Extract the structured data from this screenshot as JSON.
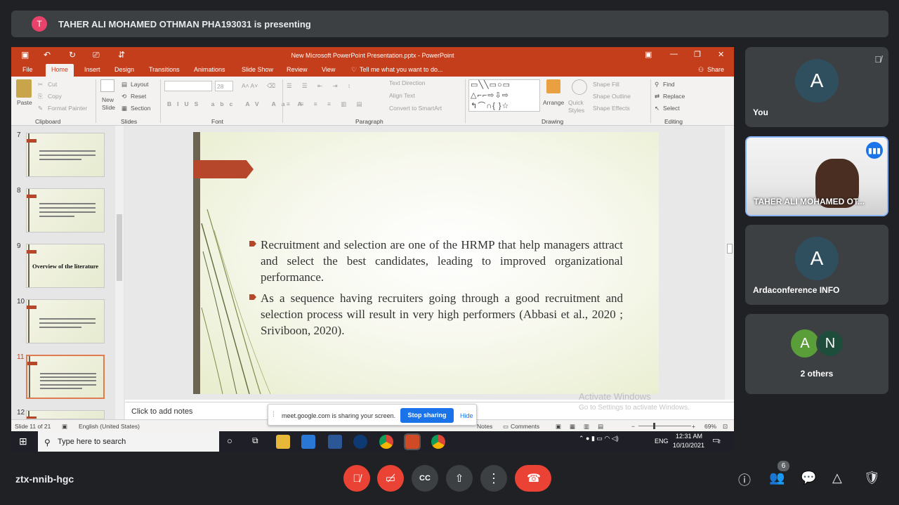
{
  "presenting_bar": {
    "avatar_letter": "T",
    "text": "TAHER ALI MOHAMED OTHMAN PHA193031 is presenting"
  },
  "ppt": {
    "title": "New Microsoft PowerPoint Presentation.pptx - PowerPoint",
    "menu": [
      "File",
      "Home",
      "Insert",
      "Design",
      "Transitions",
      "Animations",
      "Slide Show",
      "Review",
      "View"
    ],
    "tell_me": "Tell me what you want to do...",
    "share": "Share",
    "ribbon": {
      "clipboard": {
        "paste": "Paste",
        "cut": "Cut",
        "copy": "Copy",
        "format_painter": "Format Painter",
        "label": "Clipboard"
      },
      "slides": {
        "new_slide": "New Slide",
        "layout": "Layout",
        "reset": "Reset",
        "section": "Section",
        "label": "Slides"
      },
      "font": {
        "size": "28",
        "label": "Font"
      },
      "paragraph": {
        "text_direction": "Text Direction",
        "align_text": "Align Text",
        "convert": "Convert to SmartArt",
        "label": "Paragraph"
      },
      "drawing": {
        "arrange": "Arrange",
        "quick_styles": "Quick Styles",
        "shape_fill": "Shape Fill",
        "shape_outline": "Shape Outline",
        "shape_effects": "Shape Effects",
        "label": "Drawing"
      },
      "editing": {
        "find": "Find",
        "replace": "Replace",
        "select": "Select",
        "label": "Editing"
      }
    },
    "thumbnails": [
      {
        "num": "7"
      },
      {
        "num": "8"
      },
      {
        "num": "9",
        "title": "Overview of the literature"
      },
      {
        "num": "10"
      },
      {
        "num": "11",
        "selected": true
      },
      {
        "num": "12"
      }
    ],
    "slide": {
      "bullet1": "Recruitment and selection are one of the HRMP that help managers attract and select the best candidates, leading to improved organizational performance.",
      "bullet2": "As a sequence having recruiters going through a good recruitment and selection process will result in very high performers (Abbasi et al., 2020 ; Sriviboon, 2020)."
    },
    "notes_placeholder": "Click to add notes",
    "watermark": {
      "line1": "Activate Windows",
      "line2": "Go to Settings to activate Windows."
    },
    "status": {
      "slide": "Slide 11 of 21",
      "language": "English (United States)",
      "notes": "Notes",
      "comments": "Comments",
      "zoom": "69%"
    }
  },
  "share_banner": {
    "text": "meet.google.com is sharing your screen.",
    "stop": "Stop sharing",
    "hide": "Hide"
  },
  "taskbar": {
    "search": "Type here to search",
    "lang": "ENG",
    "time": "12:31 AM",
    "date": "10/10/2021",
    "notif": "2"
  },
  "tiles": {
    "you": {
      "letter": "A",
      "name": "You"
    },
    "presenter": {
      "name": "TAHER ALI MOHAMED OT..."
    },
    "arda": {
      "letter": "A",
      "name": "Ardaconference INFO"
    },
    "others": {
      "letters": [
        "A",
        "N"
      ],
      "name": "2 others",
      "colors": [
        "#5a9e3a",
        "#1e4d3c"
      ]
    }
  },
  "meeting_code": "ztx-nnib-hgc",
  "participants_count": "6",
  "colors": {
    "accent": "#c43e1c",
    "end_call": "#ea4335",
    "meet_bg": "#202124"
  }
}
